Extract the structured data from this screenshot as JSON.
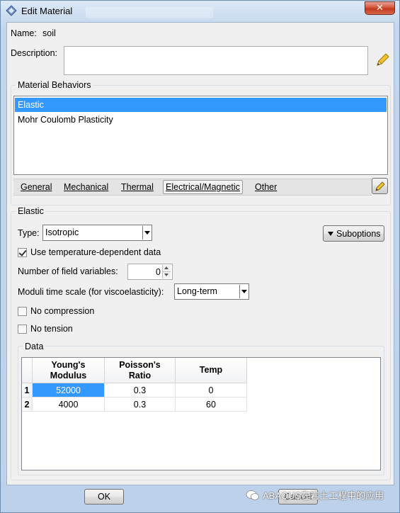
{
  "window": {
    "title": "Edit Material",
    "close_glyph": "✕"
  },
  "name": {
    "label": "Name:",
    "value": "soil"
  },
  "description": {
    "label": "Description:",
    "value": ""
  },
  "material_behaviors": {
    "title": "Material Behaviors",
    "items": [
      {
        "label": "Elastic",
        "selected": true
      },
      {
        "label": "Mohr Coulomb Plasticity",
        "selected": false
      }
    ]
  },
  "menus": {
    "general": "General",
    "mechanical": "Mechanical",
    "thermal": "Thermal",
    "electrical": "Electrical/Magnetic",
    "other": "Other"
  },
  "elastic": {
    "title": "Elastic",
    "type_label": "Type:",
    "type_value": "Isotropic",
    "suboptions_label": "Suboptions",
    "temp_dependent_label": "Use temperature-dependent data",
    "temp_dependent_checked": true,
    "field_vars_label": "Number of field variables:",
    "field_vars_value": "0",
    "moduli_label": "Moduli time scale (for viscoelasticity):",
    "moduli_value": "Long-term",
    "no_compression_label": "No compression",
    "no_compression_checked": false,
    "no_tension_label": "No tension",
    "no_tension_checked": false
  },
  "data_table": {
    "title": "Data",
    "headers": [
      {
        "line1": "Young's",
        "line2": "Modulus"
      },
      {
        "line1": "Poisson's",
        "line2": "Ratio"
      },
      {
        "line1": "Temp",
        "line2": ""
      }
    ],
    "rows": [
      {
        "index": "1",
        "cells": [
          "52000",
          "0.3",
          "0"
        ]
      },
      {
        "index": "2",
        "cells": [
          "4000",
          "0.3",
          "60"
        ]
      }
    ]
  },
  "footer": {
    "ok_label": "OK",
    "cancel_label": "Cancel"
  },
  "watermark": "ABAQUS在岩土工程中的应用",
  "colors": {
    "selection": "#3399ff",
    "close_button": "#c7432b"
  }
}
